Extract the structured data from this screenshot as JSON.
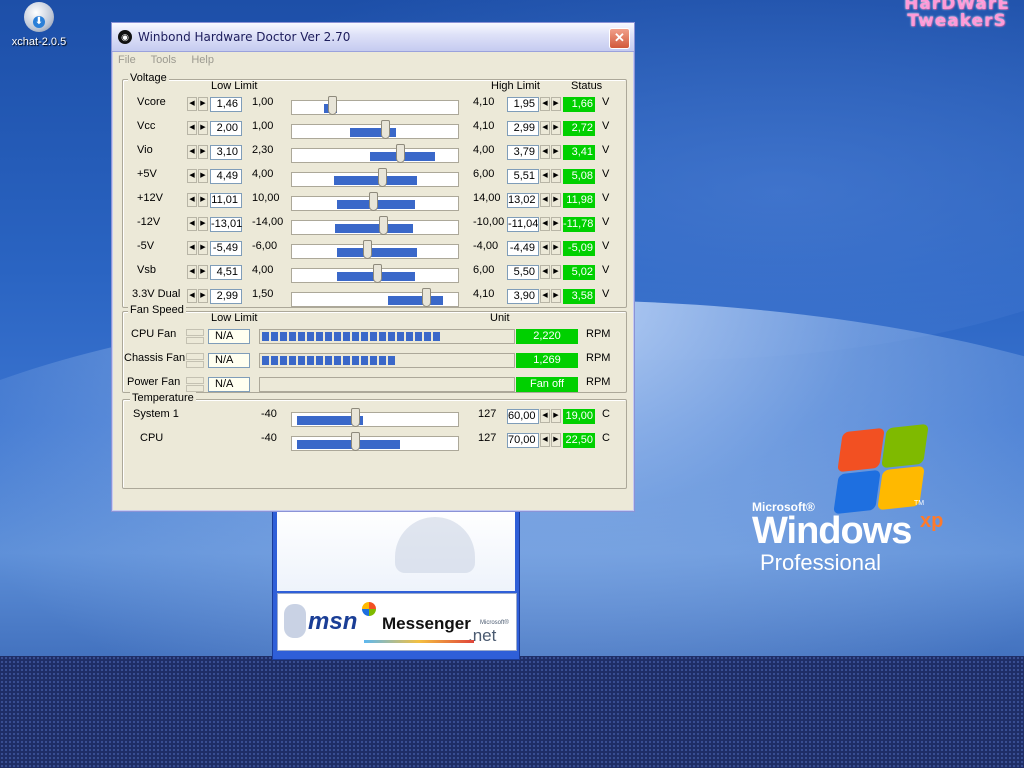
{
  "desktop": {
    "icon_label": "xchat-2.0.5",
    "corner_logo_line1": "HarDWarE",
    "corner_logo_line2": "TweakerS",
    "windows_logo": {
      "microsoft": "Microsoft®",
      "windows": "Windows",
      "xp": "xp",
      "tm": "TM",
      "edition": "Professional"
    },
    "msn": {
      "msn": "msn",
      "messenger": "Messenger",
      "net_small": "Microsoft®",
      "net": ".net"
    }
  },
  "app": {
    "title": "Winbond Hardware Doctor Ver 2.70",
    "close": "✕",
    "menu": [
      "File",
      "Tools",
      "Help"
    ],
    "voltage": {
      "label": "Voltage",
      "low_limit_header": "Low Limit",
      "high_limit_header": "High Limit",
      "status_header": "Status",
      "rows": [
        {
          "name": "Vcore",
          "low_set": "1,46",
          "min": "1,00",
          "max": "4,10",
          "high_set": "1,95",
          "status": "1,66",
          "unit": "V",
          "rng": [
            0.19,
            0.27
          ],
          "thumb": 0.24
        },
        {
          "name": "Vcc",
          "low_set": "2,00",
          "min": "1,00",
          "max": "4,10",
          "high_set": "2,99",
          "status": "2,72",
          "unit": "V",
          "rng": [
            0.35,
            0.63
          ],
          "thumb": 0.56
        },
        {
          "name": "Vio",
          "low_set": "3,10",
          "min": "2,30",
          "max": "4,00",
          "high_set": "3,79",
          "status": "3,41",
          "unit": "V",
          "rng": [
            0.47,
            0.86
          ],
          "thumb": 0.65
        },
        {
          "name": "+5V",
          "low_set": "4,49",
          "min": "4,00",
          "max": "6,00",
          "high_set": "5,51",
          "status": "5,08",
          "unit": "V",
          "rng": [
            0.25,
            0.75
          ],
          "thumb": 0.54
        },
        {
          "name": "+12V",
          "low_set": "11,01",
          "min": "10,00",
          "max": "14,00",
          "high_set": "13,02",
          "status": "11,98",
          "unit": "V",
          "rng": [
            0.27,
            0.74
          ],
          "thumb": 0.49
        },
        {
          "name": "-12V",
          "low_set": "-13,01",
          "min": "-14,00",
          "max": "-10,00",
          "high_set": "-11,04",
          "status": "-11,78",
          "unit": "V",
          "rng": [
            0.26,
            0.73
          ],
          "thumb": 0.55
        },
        {
          "name": "-5V",
          "low_set": "-5,49",
          "min": "-6,00",
          "max": "-4,00",
          "high_set": "-4,49",
          "status": "-5,09",
          "unit": "V",
          "rng": [
            0.27,
            0.75
          ],
          "thumb": 0.45
        },
        {
          "name": "Vsb",
          "low_set": "4,51",
          "min": "4,00",
          "max": "6,00",
          "high_set": "5,50",
          "status": "5,02",
          "unit": "V",
          "rng": [
            0.27,
            0.74
          ],
          "thumb": 0.51
        },
        {
          "name": "3.3V Dual",
          "low_set": "2,99",
          "min": "1,50",
          "max": "4,10",
          "high_set": "3,90",
          "status": "3,58",
          "unit": "V",
          "rng": [
            0.58,
            0.91
          ],
          "thumb": 0.81
        }
      ]
    },
    "fan": {
      "label": "Fan Speed",
      "low_limit_header": "Low Limit",
      "unit_header": "Unit",
      "rows": [
        {
          "name": "CPU Fan",
          "limit": "N/A",
          "value": "2,220",
          "unit": "RPM",
          "segments": 20
        },
        {
          "name": "Chassis Fan",
          "limit": "N/A",
          "value": "1,269",
          "unit": "RPM",
          "segments": 15
        },
        {
          "name": "Power Fan",
          "limit": "N/A",
          "value": "Fan off",
          "unit": "RPM",
          "segments": 0
        }
      ]
    },
    "temperature": {
      "label": "Temperature",
      "rows": [
        {
          "name": "System 1",
          "min": "-40",
          "max": "127",
          "high_set": "60,00",
          "status": "19,00",
          "unit": "C",
          "rng": [
            0.03,
            0.43
          ],
          "thumb": 0.38
        },
        {
          "name": "CPU",
          "min": "-40",
          "max": "127",
          "high_set": "70,00",
          "status": "22,50",
          "unit": "C",
          "rng": [
            0.03,
            0.65
          ],
          "thumb": 0.38
        }
      ]
    }
  }
}
